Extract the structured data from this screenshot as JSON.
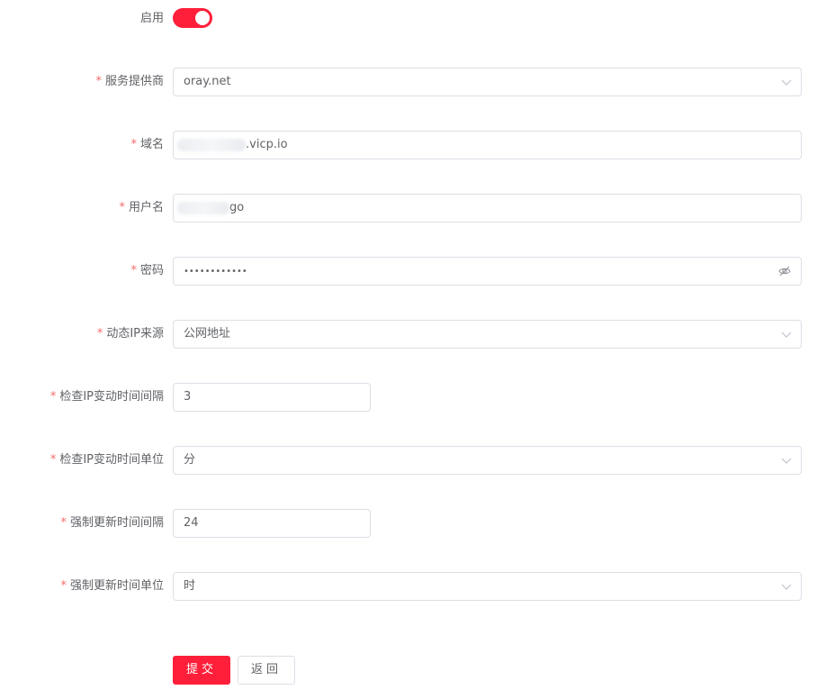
{
  "enabled": {
    "label": "启用",
    "on": true,
    "accent": "#ff1f3a"
  },
  "required_mark": "*",
  "fields": {
    "provider": {
      "label": "服务提供商",
      "value": "oray.net"
    },
    "domain": {
      "label": "域名",
      "value_visible": ".vicp.io"
    },
    "username": {
      "label": "用户名",
      "value_visible": "go"
    },
    "password": {
      "label": "密码",
      "value": "••••••••••••"
    },
    "ip_source": {
      "label": "动态IP来源",
      "value": "公网地址"
    },
    "check_interval": {
      "label": "检查IP变动时间间隔",
      "value": "3"
    },
    "check_unit": {
      "label": "检查IP变动时间单位",
      "value": "分"
    },
    "force_interval": {
      "label": "强制更新时间间隔",
      "value": "24"
    },
    "force_unit": {
      "label": "强制更新时间单位",
      "value": "时"
    }
  },
  "buttons": {
    "submit": "提交",
    "back": "返回"
  },
  "colors": {
    "primary": "#ff1f3a",
    "required": "#f56c6c",
    "border": "#dcdfe6"
  },
  "icons": {
    "select": "chevron-down-icon",
    "password_toggle": "eye-off-icon"
  }
}
